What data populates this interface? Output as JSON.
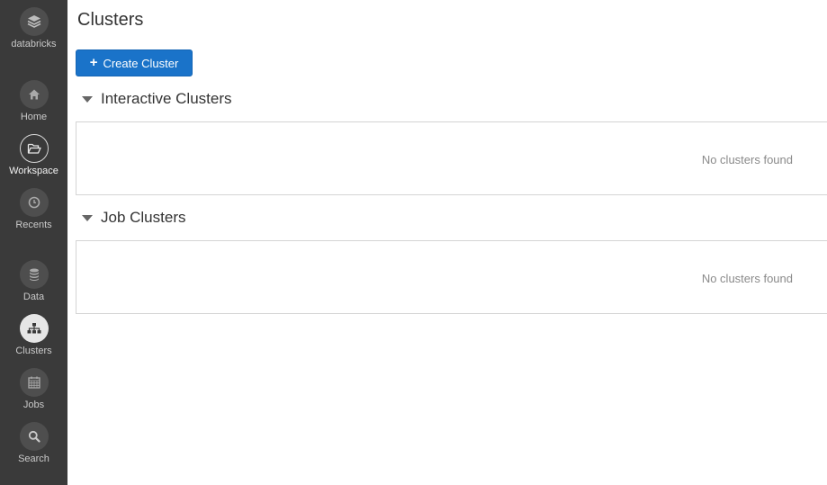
{
  "sidebar": {
    "items": [
      {
        "label": "databricks",
        "icon": "databricks-logo-icon"
      },
      {
        "label": "Home",
        "icon": "home-icon"
      },
      {
        "label": "Workspace",
        "icon": "folder-open-icon"
      },
      {
        "label": "Recents",
        "icon": "clock-icon"
      },
      {
        "label": "Data",
        "icon": "database-icon"
      },
      {
        "label": "Clusters",
        "icon": "cluster-icon"
      },
      {
        "label": "Jobs",
        "icon": "calendar-icon"
      },
      {
        "label": "Search",
        "icon": "search-icon"
      }
    ]
  },
  "main": {
    "title": "Clusters",
    "create_button": {
      "icon": "plus-icon",
      "plus": "+",
      "label": "Create Cluster"
    },
    "sections": [
      {
        "title": "Interactive Clusters",
        "empty_text": "No clusters found"
      },
      {
        "title": "Job Clusters",
        "empty_text": "No clusters found"
      }
    ]
  },
  "colors": {
    "sidebar_bg": "#3a3a3a",
    "button_blue": "#1a73c9",
    "text_dark": "#333333",
    "text_muted": "#8a8a8a"
  }
}
